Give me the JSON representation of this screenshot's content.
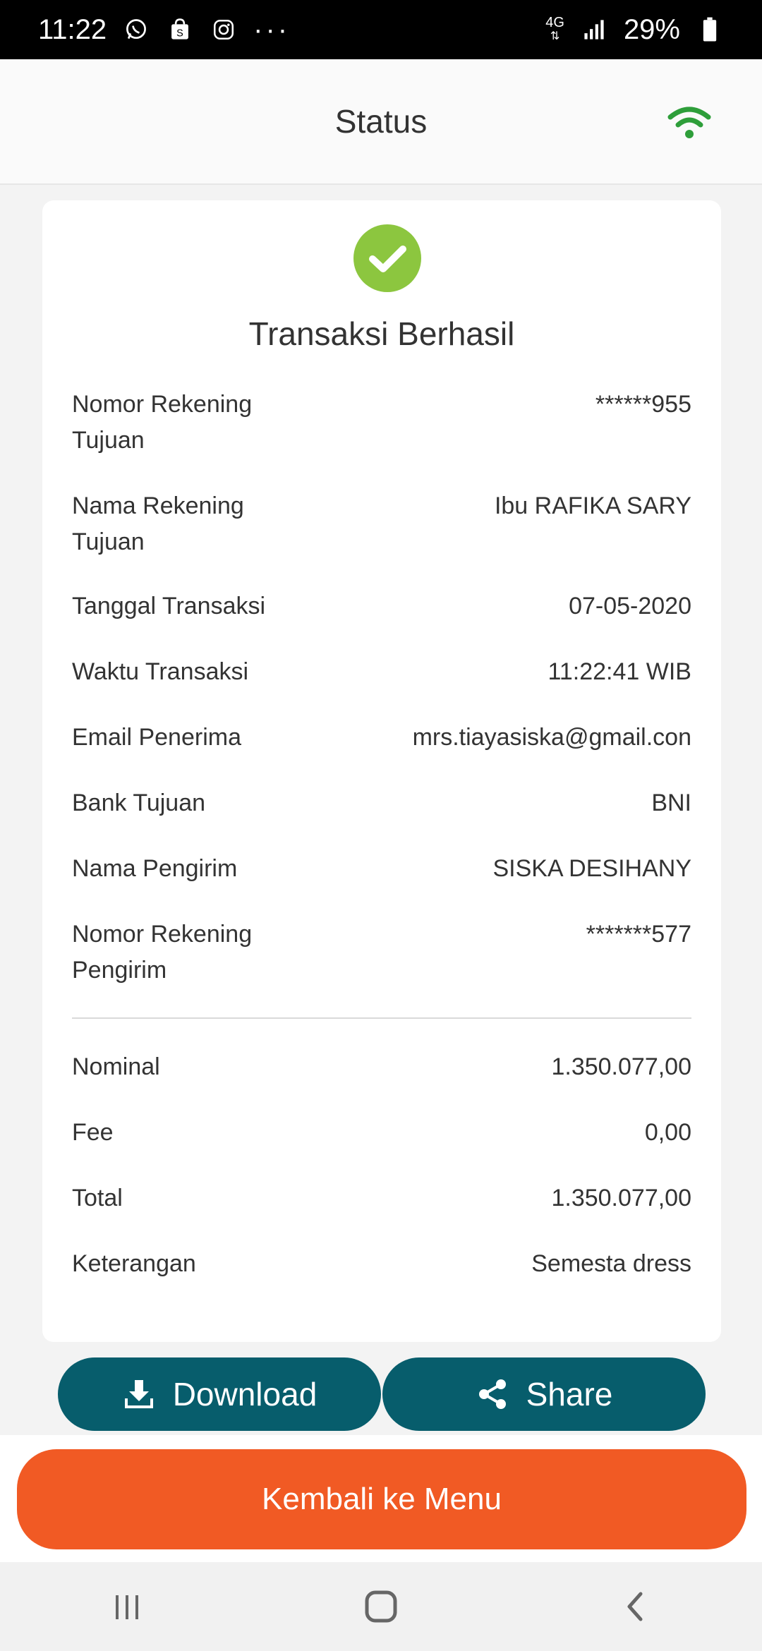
{
  "status_bar": {
    "time": "11:22",
    "more_icons": "···",
    "network": "4G",
    "battery": "29%"
  },
  "header": {
    "title": "Status"
  },
  "receipt": {
    "result_title": "Transaksi Berhasil",
    "rows": [
      {
        "label": "Nomor Rekening Tujuan",
        "value": "******955"
      },
      {
        "label": "Nama Rekening Tujuan",
        "value": "Ibu RAFIKA SARY"
      },
      {
        "label": "Tanggal Transaksi",
        "value": "07-05-2020"
      },
      {
        "label": "Waktu Transaksi",
        "value": "11:22:41 WIB"
      },
      {
        "label": "Email Penerima",
        "value": "mrs.tiayasiska@gmail.con"
      },
      {
        "label": "Bank Tujuan",
        "value": "BNI"
      },
      {
        "label": "Nama Pengirim",
        "value": "SISKA DESIHANY"
      },
      {
        "label": "Nomor Rekening Pengirim",
        "value": "*******577"
      }
    ],
    "totals": [
      {
        "label": "Nominal",
        "value": "1.350.077,00"
      },
      {
        "label": "Fee",
        "value": "0,00"
      },
      {
        "label": "Total",
        "value": "1.350.077,00"
      },
      {
        "label": "Keterangan",
        "value": "Semesta dress"
      }
    ]
  },
  "actions": {
    "download_label": "Download",
    "share_label": "Share",
    "back_label": "Kembali ke Menu"
  },
  "colors": {
    "success": "#8cc63f",
    "primary": "#075d6c",
    "accent": "#f15a24",
    "signal": "#2e9e3a"
  }
}
